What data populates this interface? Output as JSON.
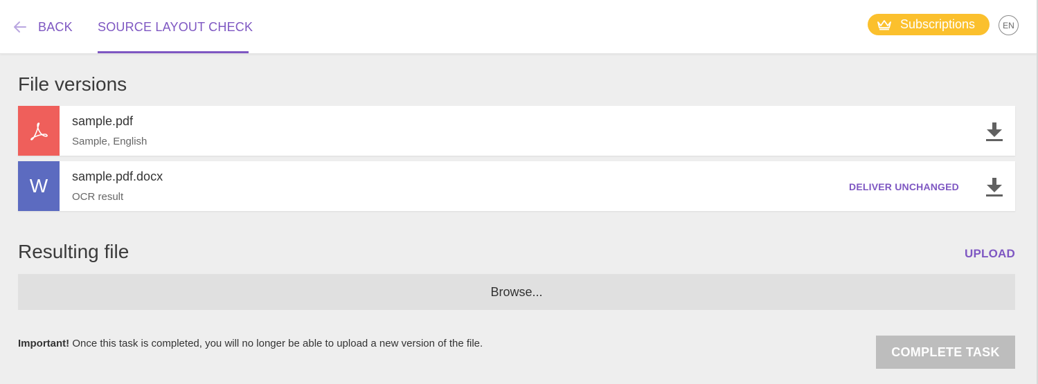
{
  "header": {
    "back_label": "BACK",
    "active_tab": "SOURCE LAYOUT CHECK",
    "subscriptions_label": "Subscriptions",
    "language": "EN"
  },
  "file_versions": {
    "title": "File versions",
    "files": [
      {
        "name": "sample.pdf",
        "description": "Sample, English",
        "icon": "pdf-icon",
        "icon_color": "#ef5f5b",
        "icon_glyph": ""
      },
      {
        "name": "sample.pdf.docx",
        "description": "OCR result",
        "icon": "word-icon",
        "icon_color": "#5c6bc0",
        "icon_glyph": "W",
        "action_label": "DELIVER UNCHANGED"
      }
    ]
  },
  "resulting_file": {
    "title": "Resulting file",
    "upload_label": "UPLOAD",
    "browse_label": "Browse..."
  },
  "footer": {
    "note_bold": "Important!",
    "note_text": " Once this task is completed, you will no longer be able to upload a new version of the file.",
    "complete_label": "COMPLETE TASK"
  },
  "colors": {
    "accent": "#7e57c2",
    "subscriptions": "#fbc02d",
    "disabled_button": "#bdbdbd"
  }
}
